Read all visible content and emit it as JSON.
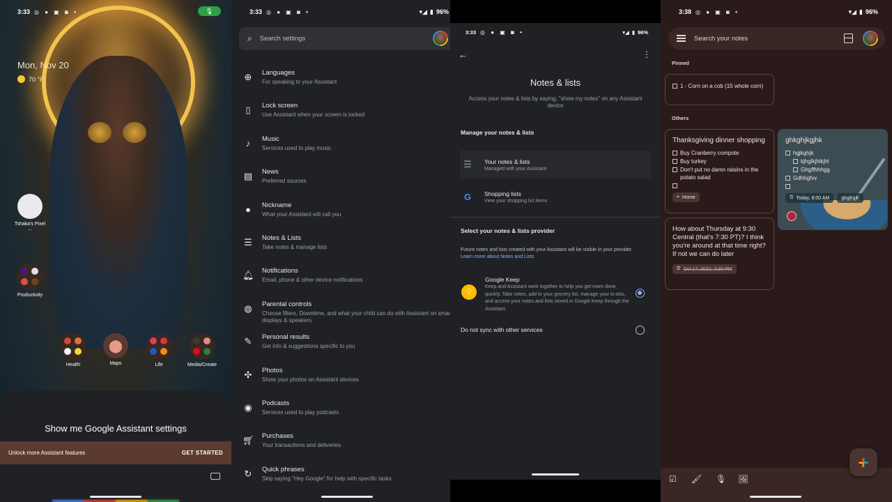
{
  "home": {
    "time": "3:33",
    "battery": "",
    "date": "Mon, Nov 20",
    "weather": "70 °F",
    "contact_label": "Tshaka's Pixel ...",
    "folders": [
      {
        "label": "Productivity"
      },
      {
        "label": "Health"
      },
      {
        "label": "Maps"
      },
      {
        "label": "Life"
      },
      {
        "label": "Media/Create"
      }
    ],
    "assistant_query": "Show me Google Assistant settings",
    "banner_text": "Unlock more Assistant features",
    "banner_cta": "GET STARTED"
  },
  "settings": {
    "time": "3:33",
    "battery": "96%",
    "search_placeholder": "Search settings",
    "items": [
      {
        "title": "Languages",
        "subtitle": "For speaking to your Assistant",
        "icon": "globe-icon"
      },
      {
        "title": "Lock screen",
        "subtitle": "Use Assistant when your screen is locked",
        "icon": "lock-screen-icon"
      },
      {
        "title": "Music",
        "subtitle": "Services used to play music",
        "icon": "music-note-icon"
      },
      {
        "title": "News",
        "subtitle": "Preferred sources",
        "icon": "news-icon"
      },
      {
        "title": "Nickname",
        "subtitle": "What your Assistant will call you",
        "icon": "person-icon"
      },
      {
        "title": "Notes & Lists",
        "subtitle": "Take notes & manage lists",
        "icon": "list-icon"
      },
      {
        "title": "Notifications",
        "subtitle": "Email, phone & other device notifications",
        "icon": "bell-icon"
      },
      {
        "title": "Parental controls",
        "subtitle": "Choose filters, Downtime, and what your child can do with Assistant on smart displays & speakers",
        "icon": "parental-controls-icon"
      },
      {
        "title": "Personal results",
        "subtitle": "Get info & suggestions specific to you",
        "icon": "personal-results-icon"
      },
      {
        "title": "Photos",
        "subtitle": "Show your photos on Assistant devices",
        "icon": "pinwheel-icon"
      },
      {
        "title": "Podcasts",
        "subtitle": "Services used to play podcasts",
        "icon": "podcast-icon"
      },
      {
        "title": "Purchases",
        "subtitle": "Your transactions and deliveries",
        "icon": "cart-icon"
      },
      {
        "title": "Quick phrases",
        "subtitle": "Skip saying “Hey Google” for help with specific tasks",
        "icon": "quick-phrases-icon"
      }
    ]
  },
  "notes_settings": {
    "time": "3:33",
    "battery": "96%",
    "title": "Notes & lists",
    "description": "Access your notes & lists by saying, \"show my notes\" on any Assistant device",
    "manage_heading": "Manage your notes & lists",
    "your_notes_title": "Your notes & lists",
    "your_notes_sub": "Managed with your Assistant",
    "shopping_title": "Shopping lists",
    "shopping_sub": "View your shopping list items",
    "provider_heading": "Select your notes & lists provider",
    "future_text": "Future notes and lists created with your Assistant will be visible in your provider.",
    "learn_more": "Learn more about Notes and Lists",
    "keep_title": "Google Keep",
    "keep_desc": "Keep and Assistant work together to help you get more done, quickly. Take notes, add to your grocery list, manage your to-dos, and access your notes and lists stored in Google Keep through the Assistant.",
    "no_sync": "Do not sync with other services",
    "selected_provider": "Google Keep"
  },
  "keep": {
    "time": "3:38",
    "battery": "96%",
    "search_placeholder": "Search your notes",
    "pinned_label": "Pinned",
    "others_label": "Others",
    "pinned_note": {
      "items": [
        "1 - Corn on a cob (15 whole corn)"
      ]
    },
    "thanksgiving": {
      "title": "Thanksgiving dinner shopping",
      "items": [
        "Buy Cranberry compote",
        "Buy turkey",
        "Don't put no damn raisins in the potato salad",
        ""
      ],
      "label": "Home"
    },
    "thursday": {
      "title": "How about Thursday at 9:30 Central (that's 7:30 PT)? I think you're around at that time right? If not we can do later",
      "reminder": "Oct 17, 2022, 3:30 PM"
    },
    "ghk": {
      "title": "ghkghjkgjhk",
      "items": [
        "hgjkghjk"
      ],
      "subitems": [
        "kjhglkjhlkjhl",
        "Ghgffhhhgg"
      ],
      "items2": [
        "Gdhhgfvv",
        ""
      ],
      "reminder": "Today, 8:00 AM",
      "label": "gkgjkgjk"
    }
  },
  "colors": {
    "accent_blue": "#8ab4f8",
    "keep_yellow": "#fbbc04",
    "mic_green": "#2f9e45"
  }
}
